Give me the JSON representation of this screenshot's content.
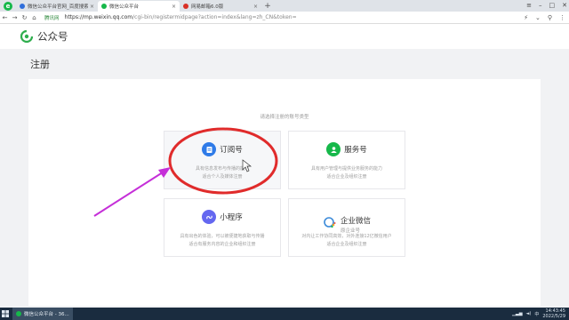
{
  "browser": {
    "tabs": [
      {
        "title": "微信公众平台官网_百度搜索",
        "fav_color": "#2f6edb"
      },
      {
        "title": "微信公众平台",
        "fav_color": "#16b84a"
      },
      {
        "title": "网易邮箱6.0版",
        "fav_color": "#d93025"
      }
    ],
    "secure_label": "腾讯网",
    "url_host": "https://mp.weixin.qq.com",
    "url_path": "/cgi-bin/registermidpage?action=index&lang=zh_CN&token="
  },
  "header": {
    "logo_text": "公众号"
  },
  "page": {
    "title": "注册",
    "hint": "请选择注册的账号类型"
  },
  "cards": [
    {
      "name": "订阅号",
      "sub": "",
      "desc1": "具有信息发布与传播的能力",
      "desc2": "适合个人及媒体注册",
      "icon_color": "#2f7be8",
      "icon": "doc-icon"
    },
    {
      "name": "服务号",
      "sub": "",
      "desc1": "具有用户管理与提供业务服务的能力",
      "desc2": "适合企业及组织注册",
      "icon_color": "#16b84a",
      "icon": "person-icon"
    },
    {
      "name": "小程序",
      "sub": "",
      "desc1": "具有出色的体验，可以被便捷地获取与传播",
      "desc2": "适合有服务内容的企业和组织注册",
      "icon_color": "#6467f0",
      "icon": "miniprogram-icon"
    },
    {
      "name": "企业微信",
      "sub": "原企业号",
      "desc1": "对内让工作协同高效，对外连接12亿微信用户",
      "desc2": "适合企业及组织注册",
      "icon_color": "#3b8ad9",
      "icon": "wecom-icon"
    }
  ],
  "taskbar": {
    "active_app": "微信公众平台 - 36...",
    "time": "14:43:45",
    "date": "2022/5/29"
  },
  "colors": {
    "accent": "#16b84a",
    "annotation_red": "#e02b2b",
    "annotation_arrow": "#c52fd8"
  }
}
